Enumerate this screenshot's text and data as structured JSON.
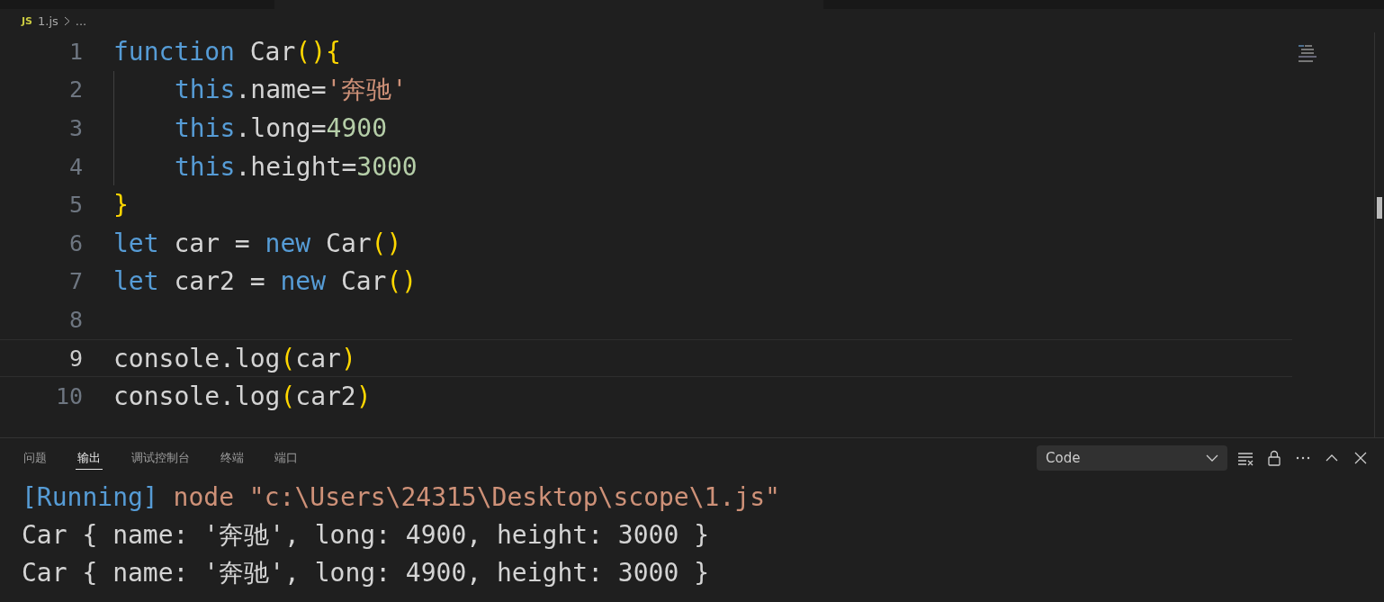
{
  "breadcrumb": {
    "file_badge": "JS",
    "file": "1.js",
    "rest": "..."
  },
  "editor": {
    "lines": [
      {
        "number": "1",
        "current": false,
        "guide": false,
        "tokens": [
          {
            "kind": "keyword",
            "text": "function "
          },
          {
            "kind": "plain",
            "text": "Car"
          },
          {
            "kind": "bracket",
            "text": "()"
          },
          {
            "kind": "bracket",
            "text": "{"
          }
        ]
      },
      {
        "number": "2",
        "current": false,
        "guide": true,
        "tokens": [
          {
            "kind": "keyword",
            "text": "this"
          },
          {
            "kind": "plain",
            "text": ".name="
          },
          {
            "kind": "string",
            "text": "'奔驰'"
          }
        ]
      },
      {
        "number": "3",
        "current": false,
        "guide": true,
        "tokens": [
          {
            "kind": "keyword",
            "text": "this"
          },
          {
            "kind": "plain",
            "text": ".long="
          },
          {
            "kind": "number",
            "text": "4900"
          }
        ]
      },
      {
        "number": "4",
        "current": false,
        "guide": true,
        "tokens": [
          {
            "kind": "keyword",
            "text": "this"
          },
          {
            "kind": "plain",
            "text": ".height="
          },
          {
            "kind": "number",
            "text": "3000"
          }
        ]
      },
      {
        "number": "5",
        "current": false,
        "guide": false,
        "tokens": [
          {
            "kind": "bracket",
            "text": "}"
          }
        ]
      },
      {
        "number": "6",
        "current": false,
        "guide": false,
        "tokens": [
          {
            "kind": "keyword",
            "text": "let "
          },
          {
            "kind": "plain",
            "text": "car = "
          },
          {
            "kind": "keyword",
            "text": "new "
          },
          {
            "kind": "plain",
            "text": "Car"
          },
          {
            "kind": "bracket",
            "text": "()"
          }
        ]
      },
      {
        "number": "7",
        "current": false,
        "guide": false,
        "tokens": [
          {
            "kind": "keyword",
            "text": "let "
          },
          {
            "kind": "plain",
            "text": "car2 = "
          },
          {
            "kind": "keyword",
            "text": "new "
          },
          {
            "kind": "plain",
            "text": "Car"
          },
          {
            "kind": "bracket",
            "text": "()"
          }
        ]
      },
      {
        "number": "8",
        "current": false,
        "guide": false
      },
      {
        "number": "9",
        "current": true,
        "guide": false,
        "tokens": [
          {
            "kind": "plain",
            "text": "console.log"
          },
          {
            "kind": "bracket",
            "text": "("
          },
          {
            "kind": "plain",
            "text": "car"
          },
          {
            "kind": "bracket",
            "text": ")"
          }
        ]
      },
      {
        "number": "10",
        "current": false,
        "guide": false,
        "tokens": [
          {
            "kind": "plain",
            "text": "console.log"
          },
          {
            "kind": "bracket",
            "text": "("
          },
          {
            "kind": "plain",
            "text": "car2"
          },
          {
            "kind": "bracket",
            "text": ")"
          }
        ]
      }
    ]
  },
  "panel": {
    "tabs": [
      {
        "label": "问题",
        "selected": false
      },
      {
        "label": "输出",
        "selected": true
      },
      {
        "label": "调试控制台",
        "selected": false
      },
      {
        "label": "终端",
        "selected": false
      },
      {
        "label": "端口",
        "selected": false
      }
    ],
    "channel_select": {
      "value": "Code"
    },
    "output": [
      {
        "tokens": [
          {
            "kind": "keyword",
            "text": "[Running] "
          },
          {
            "kind": "string",
            "text": "node \"c:\\Users\\24315\\Desktop\\scope\\1.js\""
          }
        ]
      },
      {
        "tokens": [
          {
            "kind": "plain",
            "text": "Car { name: '奔驰', long: 4900, height: 3000 }"
          }
        ]
      },
      {
        "tokens": [
          {
            "kind": "plain",
            "text": "Car { name: '奔驰', long: 4900, height: 3000 }"
          }
        ]
      }
    ]
  }
}
